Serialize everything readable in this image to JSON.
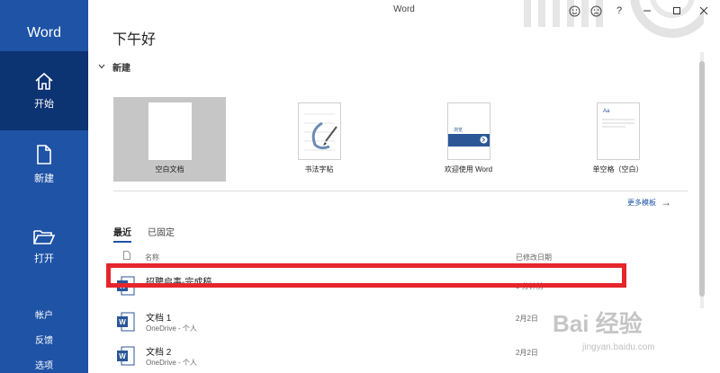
{
  "app": {
    "title": "Word",
    "name": "Word"
  },
  "sidebar": {
    "items": [
      {
        "label": "开始",
        "icon": "home-icon"
      },
      {
        "label": "新建",
        "icon": "new-document-icon"
      },
      {
        "label": "打开",
        "icon": "open-folder-icon"
      }
    ],
    "bottom": [
      {
        "label": "帐户"
      },
      {
        "label": "反馈"
      },
      {
        "label": "选项"
      }
    ]
  },
  "titlebar": {
    "controls": [
      "smile-icon",
      "frown-icon",
      "help-icon",
      "minimize-icon",
      "restore-icon",
      "close-icon"
    ],
    "help": "?"
  },
  "greeting": "下午好",
  "new_section": {
    "label": "新建",
    "templates": [
      {
        "label": "空白文档",
        "selected": true
      },
      {
        "label": "书法字帖"
      },
      {
        "label": "欢迎使用 Word",
        "thumb_text": "浏览"
      },
      {
        "label": "单空格（空白）",
        "thumb_text": "Aa"
      }
    ],
    "more_templates": "更多模板"
  },
  "recent": {
    "tabs": [
      {
        "label": "最近",
        "active": true
      },
      {
        "label": "已固定"
      }
    ],
    "columns": {
      "name": "名称",
      "date": "已修改日期"
    },
    "files": [
      {
        "name": "招聘启事-完成稿",
        "location": "",
        "date": "3 分钟前"
      },
      {
        "name": "文档 1",
        "location": "OneDrive - 个人",
        "date": "2月2日"
      },
      {
        "name": "文档 2",
        "location": "OneDrive - 个人",
        "date": "2月2日"
      }
    ]
  },
  "watermark": {
    "brand": "Bai 经验",
    "url": "jingyan.baidu.com"
  },
  "colors": {
    "sidebar": "#1e53a6",
    "sidebar_active": "#0c3372",
    "highlight": "#e5262c",
    "accent": "#1e53a6"
  }
}
